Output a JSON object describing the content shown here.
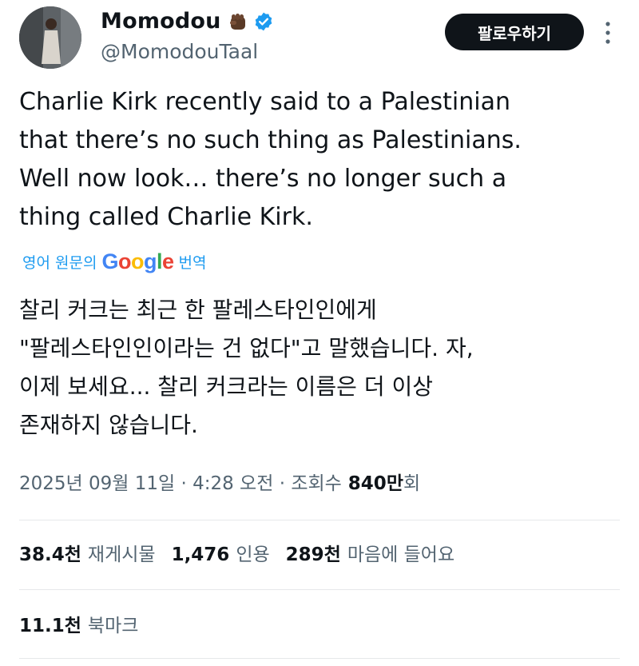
{
  "user": {
    "display_name": "Momodou",
    "handle": "@MomodouTaal",
    "badge_emoji": "fist-icon",
    "verified_color": "#1d9bf0"
  },
  "follow_button": {
    "label": "팔로우하기"
  },
  "tweet": {
    "lines": [
      "Charlie Kirk recently said to a Palestinian",
      "that there’s no such thing as Palestinians.",
      "Well now look… there’s no longer such a",
      "thing called Charlie Kirk."
    ]
  },
  "translation": {
    "prefix": "영어 원문의",
    "google_letters": [
      "G",
      "o",
      "o",
      "g",
      "l",
      "e"
    ],
    "suffix": "번역",
    "lines": [
      "찰리 커크는 최근 한 팔레스타인인에게",
      "\"팔레스타인인이라는 건 없다\"고 말했습니다. 자,",
      "이제 보세요... 찰리 커크라는 이름은 더 이상",
      "존재하지 않습니다."
    ]
  },
  "meta": {
    "date_time": "2025년 09월 11일 · 4:28 오전 · 조회수",
    "views_number": "840",
    "views_unit": "만",
    "views_suffix": "회"
  },
  "stats": {
    "retweets": {
      "number": "38.4천",
      "label": "재게시물"
    },
    "quotes": {
      "number": "1,476",
      "label": "인용"
    },
    "likes": {
      "number": "289천",
      "label": "마음에 들어요"
    }
  },
  "bookmarks": {
    "number": "11.1천",
    "label": "북마크"
  },
  "colors": {
    "text_primary": "#0f1419",
    "text_secondary": "#536471",
    "link": "#1d9bf0",
    "divider": "#e6e8ea"
  }
}
